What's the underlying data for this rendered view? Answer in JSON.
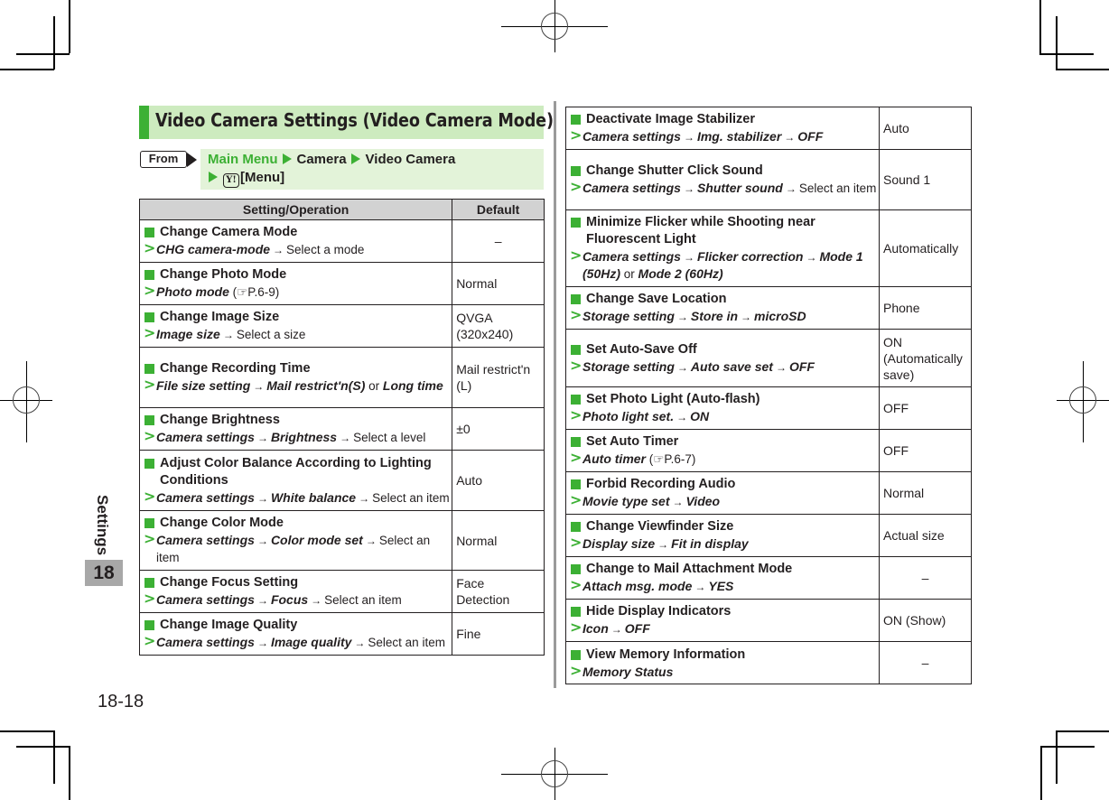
{
  "header": {
    "title": "Video Camera Settings (Video Camera Mode)",
    "from_label": "From",
    "nav": {
      "main_menu": "Main Menu",
      "camera": "Camera",
      "video_camera": "Video Camera",
      "key_glyph": "Y!",
      "menu": "[Menu]"
    }
  },
  "table_headers": {
    "operation": "Setting/Operation",
    "default": "Default"
  },
  "left_rows": [
    {
      "title": "Change Camera Mode",
      "path": [
        {
          "t": "CHG camera-mode",
          "s": "bi"
        },
        {
          "t": "→",
          "s": "arr"
        },
        {
          "t": "Select a mode",
          "s": "p"
        }
      ],
      "default": "–",
      "center": true
    },
    {
      "title": "Change Photo Mode",
      "path": [
        {
          "t": "Photo mode",
          "s": "bi"
        },
        {
          "t": " (☞P.6-9)",
          "s": "p"
        }
      ],
      "default": "Normal"
    },
    {
      "title": "Change Image Size",
      "path": [
        {
          "t": "Image size",
          "s": "bi"
        },
        {
          "t": "→",
          "s": "arr"
        },
        {
          "t": "Select a size",
          "s": "p"
        }
      ],
      "default": "QVGA (320x240)"
    },
    {
      "title": "Change Recording Time",
      "path": [
        {
          "t": "File size setting",
          "s": "bi"
        },
        {
          "t": "→",
          "s": "arr"
        },
        {
          "t": "Mail restrict'n(S)",
          "s": "bi"
        },
        {
          "t": " or ",
          "s": "p"
        },
        {
          "t": "Long time",
          "s": "bi"
        }
      ],
      "default": "Mail restrict'n (L)"
    },
    {
      "title": "Change Brightness",
      "path": [
        {
          "t": "Camera settings",
          "s": "bi"
        },
        {
          "t": "→",
          "s": "arr"
        },
        {
          "t": "Brightness",
          "s": "bi"
        },
        {
          "t": "→",
          "s": "arr"
        },
        {
          "t": "Select a level",
          "s": "p"
        }
      ],
      "default": "±0"
    },
    {
      "title": "Adjust Color Balance According to Lighting Conditions",
      "path": [
        {
          "t": "Camera settings",
          "s": "bi"
        },
        {
          "t": "→",
          "s": "arr"
        },
        {
          "t": "White balance",
          "s": "bi"
        },
        {
          "t": "→",
          "s": "arr"
        },
        {
          "t": "Select an item",
          "s": "p"
        }
      ],
      "default": "Auto"
    },
    {
      "title": "Change Color Mode",
      "path": [
        {
          "t": "Camera settings",
          "s": "bi"
        },
        {
          "t": "→",
          "s": "arr"
        },
        {
          "t": "Color mode set",
          "s": "bi"
        },
        {
          "t": "→",
          "s": "arr"
        },
        {
          "t": "Select an item",
          "s": "p"
        }
      ],
      "default": "Normal"
    },
    {
      "title": "Change Focus Setting",
      "path": [
        {
          "t": "Camera settings",
          "s": "bi"
        },
        {
          "t": "→",
          "s": "arr"
        },
        {
          "t": "Focus",
          "s": "bi"
        },
        {
          "t": "→",
          "s": "arr"
        },
        {
          "t": "Select an item",
          "s": "p"
        }
      ],
      "default": "Face Detection"
    },
    {
      "title": "Change Image Quality",
      "path": [
        {
          "t": "Camera settings",
          "s": "bi"
        },
        {
          "t": "→",
          "s": "arr"
        },
        {
          "t": "Image quality",
          "s": "bi"
        },
        {
          "t": "→",
          "s": "arr"
        },
        {
          "t": "Select an item",
          "s": "p"
        }
      ],
      "default": "Fine"
    }
  ],
  "right_rows": [
    {
      "title": "Deactivate Image Stabilizer",
      "path": [
        {
          "t": "Camera settings",
          "s": "bi"
        },
        {
          "t": "→",
          "s": "arr"
        },
        {
          "t": "Img. stabilizer",
          "s": "bi"
        },
        {
          "t": "→",
          "s": "arr"
        },
        {
          "t": "OFF",
          "s": "bi"
        }
      ],
      "default": "Auto"
    },
    {
      "title": "Change Shutter Click Sound",
      "path": [
        {
          "t": "Camera settings",
          "s": "bi"
        },
        {
          "t": "→",
          "s": "arr"
        },
        {
          "t": "Shutter sound",
          "s": "bi"
        },
        {
          "t": "→",
          "s": "arr"
        },
        {
          "t": "Select an item",
          "s": "p"
        }
      ],
      "default": "Sound 1"
    },
    {
      "title": "Minimize Flicker while Shooting near Fluorescent Light",
      "path": [
        {
          "t": "Camera settings",
          "s": "bi"
        },
        {
          "t": "→",
          "s": "arr"
        },
        {
          "t": "Flicker correction",
          "s": "bi"
        },
        {
          "t": "→",
          "s": "arr"
        },
        {
          "t": "Mode 1 (50Hz)",
          "s": "bi"
        },
        {
          "t": " or ",
          "s": "p"
        },
        {
          "t": "Mode 2 (60Hz)",
          "s": "bi"
        }
      ],
      "default": "Automatically"
    },
    {
      "title": "Change Save Location",
      "path": [
        {
          "t": "Storage setting",
          "s": "bi"
        },
        {
          "t": "→",
          "s": "arr"
        },
        {
          "t": "Store in",
          "s": "bi"
        },
        {
          "t": "→",
          "s": "arr"
        },
        {
          "t": "microSD",
          "s": "bi"
        }
      ],
      "default": "Phone"
    },
    {
      "title": "Set Auto-Save Off",
      "path": [
        {
          "t": "Storage setting",
          "s": "bi"
        },
        {
          "t": "→",
          "s": "arr"
        },
        {
          "t": "Auto save set",
          "s": "bi"
        },
        {
          "t": "→",
          "s": "arr"
        },
        {
          "t": "OFF",
          "s": "bi"
        }
      ],
      "default": "ON (Automatically save)"
    },
    {
      "title": "Set Photo Light (Auto-flash)",
      "path": [
        {
          "t": "Photo light set.",
          "s": "bi"
        },
        {
          "t": "→",
          "s": "arr"
        },
        {
          "t": "ON",
          "s": "bi"
        }
      ],
      "default": "OFF"
    },
    {
      "title": "Set Auto Timer",
      "path": [
        {
          "t": "Auto timer",
          "s": "bi"
        },
        {
          "t": " (☞P.6-7)",
          "s": "p"
        }
      ],
      "default": "OFF"
    },
    {
      "title": "Forbid Recording Audio",
      "path": [
        {
          "t": "Movie type set",
          "s": "bi"
        },
        {
          "t": "→",
          "s": "arr"
        },
        {
          "t": "Video",
          "s": "bi"
        }
      ],
      "default": "Normal"
    },
    {
      "title": "Change Viewfinder Size",
      "path": [
        {
          "t": "Display size",
          "s": "bi"
        },
        {
          "t": "→",
          "s": "arr"
        },
        {
          "t": "Fit in display",
          "s": "bi"
        }
      ],
      "default": "Actual size"
    },
    {
      "title": "Change to Mail Attachment Mode",
      "path": [
        {
          "t": "Attach msg. mode",
          "s": "bi"
        },
        {
          "t": "→",
          "s": "arr"
        },
        {
          "t": "YES",
          "s": "bi"
        }
      ],
      "default": "–",
      "center": true
    },
    {
      "title": "Hide Display Indicators",
      "path": [
        {
          "t": "Icon",
          "s": "bi"
        },
        {
          "t": "→",
          "s": "arr"
        },
        {
          "t": "OFF",
          "s": "bi"
        }
      ],
      "default": "ON (Show)"
    },
    {
      "title": "View Memory Information",
      "path": [
        {
          "t": "Memory Status",
          "s": "bi"
        }
      ],
      "default": "–",
      "center": true
    }
  ],
  "side_tab": {
    "label": "Settings",
    "chapter": "18"
  },
  "footer": {
    "page_number": "18-18"
  },
  "colors": {
    "accent_green": "#3cb034",
    "title_bg": "#cdebbf",
    "nav_bg": "#e3f3d9",
    "header_gray": "#d2d2d2",
    "chapter_gray": "#a8a8a8"
  }
}
